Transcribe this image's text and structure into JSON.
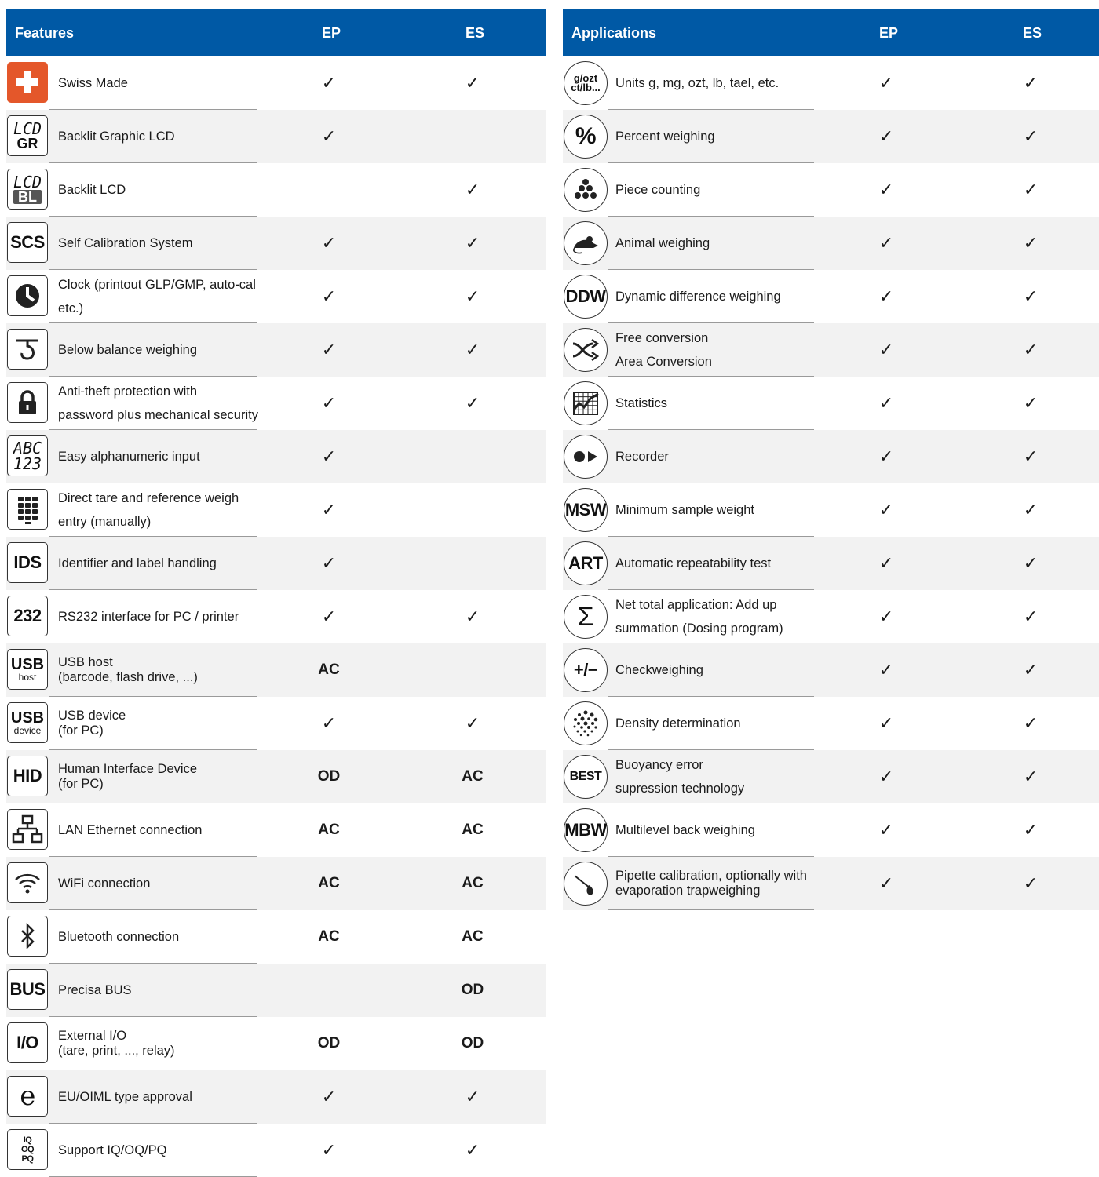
{
  "features": {
    "header": {
      "title": "Features",
      "ep": "EP",
      "es": "ES"
    },
    "rows": [
      {
        "icon": "swiss-cross-icon",
        "label": "Swiss Made",
        "ep": "✓",
        "es": "✓"
      },
      {
        "icon": "lcd-gr-icon",
        "icon_top": "LCD",
        "icon_bottom": "GR",
        "label": "Backlit Graphic LCD",
        "ep": "✓",
        "es": ""
      },
      {
        "icon": "lcd-bl-icon",
        "icon_top": "LCD",
        "icon_bottom": "BL",
        "label": "Backlit LCD",
        "ep": "",
        "es": "✓"
      },
      {
        "icon": "scs-icon",
        "icon_text": "SCS",
        "label": "Self Calibration System",
        "ep": "✓",
        "es": "✓"
      },
      {
        "icon": "clock-icon",
        "label": "Clock (printout GLP/GMP, auto-cal",
        "label2": "etc.)",
        "ep": "✓",
        "es": "✓"
      },
      {
        "icon": "below-balance-hook-icon",
        "label": "Below balance weighing",
        "ep": "✓",
        "es": "✓"
      },
      {
        "icon": "padlock-icon",
        "label": "Anti-theft protection with",
        "label2": "password plus mechanical security",
        "ep": "✓",
        "es": "✓"
      },
      {
        "icon": "abc-123-icon",
        "icon_top": "ABC",
        "icon_bottom": "123",
        "label": "Easy alphanumeric input",
        "ep": "✓",
        "es": ""
      },
      {
        "icon": "keypad-icon",
        "label": "Direct tare and reference weigh",
        "label2": "entry (manually)",
        "ep": "✓",
        "es": ""
      },
      {
        "icon": "ids-icon",
        "icon_text": "IDS",
        "label": "Identifier and label handling",
        "ep": "✓",
        "es": ""
      },
      {
        "icon": "rs232-icon",
        "icon_text": "232",
        "label": "RS232 interface for PC / printer",
        "ep": "✓",
        "es": "✓"
      },
      {
        "icon": "usb-host-icon",
        "icon_top": "USB",
        "icon_bottom": "host",
        "label": "USB host",
        "label2": "(barcode, flash drive, ...)",
        "tight": true,
        "ep": "AC",
        "es": ""
      },
      {
        "icon": "usb-device-icon",
        "icon_top": "USB",
        "icon_bottom": "device",
        "label": "USB device",
        "label2": "(for PC)",
        "tight": true,
        "ep": "✓",
        "es": "✓"
      },
      {
        "icon": "hid-icon",
        "icon_text": "HID",
        "label": "Human Interface Device",
        "label2": "(for PC)",
        "tight": true,
        "ep": "OD",
        "es": "AC"
      },
      {
        "icon": "lan-network-icon",
        "label": "LAN Ethernet connection",
        "ep": "AC",
        "es": "AC"
      },
      {
        "icon": "wifi-icon",
        "label": "WiFi connection",
        "ep": "AC",
        "es": "AC"
      },
      {
        "icon": "bluetooth-icon",
        "label": "Bluetooth connection",
        "ep": "AC",
        "es": "AC"
      },
      {
        "icon": "bus-icon",
        "icon_text": "BUS",
        "label": "Precisa BUS",
        "ep": "",
        "es": "OD"
      },
      {
        "icon": "io-icon",
        "icon_text": "I/O",
        "label": "External I/O",
        "label2": "(tare, print, ..., relay)",
        "tight": true,
        "ep": "OD",
        "es": "OD"
      },
      {
        "icon": "e-mark-icon",
        "icon_text": "e",
        "label": "EU/OIML type approval",
        "ep": "✓",
        "es": "✓"
      },
      {
        "icon": "iq-oq-pq-icon",
        "icon_text": "IQ OQ PQ",
        "label": "Support IQ/OQ/PQ",
        "ep": "✓",
        "es": "✓"
      }
    ]
  },
  "applications": {
    "header": {
      "title": "Applications",
      "ep": "EP",
      "es": "ES"
    },
    "rows": [
      {
        "icon": "units-icon",
        "icon_top": "g/ozt",
        "icon_bottom": "ct/lb...",
        "label": "Units g, mg, ozt, lb, tael, etc.",
        "ep": "✓",
        "es": "✓"
      },
      {
        "icon": "percent-icon",
        "icon_text": "%",
        "label": "Percent weighing",
        "ep": "✓",
        "es": "✓"
      },
      {
        "icon": "piece-counting-icon",
        "label": "Piece counting",
        "ep": "✓",
        "es": "✓"
      },
      {
        "icon": "mouse-icon",
        "label": "Animal weighing",
        "ep": "✓",
        "es": "✓"
      },
      {
        "icon": "ddw-icon",
        "icon_text": "DDW",
        "label": "Dynamic difference weighing",
        "ep": "✓",
        "es": "✓"
      },
      {
        "icon": "shuffle-arrows-icon",
        "label": "Free conversion",
        "label2": "Area Conversion",
        "ep": "✓",
        "es": "✓"
      },
      {
        "icon": "statistics-chart-icon",
        "label": "Statistics",
        "ep": "✓",
        "es": "✓"
      },
      {
        "icon": "recorder-icon",
        "label": "Recorder",
        "ep": "✓",
        "es": "✓"
      },
      {
        "icon": "msw-icon",
        "icon_text": "MSW",
        "label": "Minimum sample weight",
        "ep": "✓",
        "es": "✓"
      },
      {
        "icon": "art-icon",
        "icon_text": "ART",
        "label": "Automatic repeatability test",
        "ep": "✓",
        "es": "✓"
      },
      {
        "icon": "sigma-icon",
        "icon_text": "Σ",
        "label": "Net total application: Add up",
        "label2": "summation (Dosing program)",
        "ep": "✓",
        "es": "✓"
      },
      {
        "icon": "plus-minus-icon",
        "icon_text": "+/−",
        "label": "Checkweighing",
        "ep": "✓",
        "es": "✓"
      },
      {
        "icon": "density-dots-icon",
        "label": "Density determination",
        "ep": "✓",
        "es": "✓"
      },
      {
        "icon": "best-icon",
        "icon_text": "BEST",
        "label": "Buoyancy error",
        "label2": "supression technology",
        "ep": "✓",
        "es": "✓"
      },
      {
        "icon": "mbw-icon",
        "icon_text": "MBW",
        "label": "Multilevel back weighing",
        "ep": "✓",
        "es": "✓"
      },
      {
        "icon": "pipette-icon",
        "label": "Pipette calibration, optionally with",
        "label2": "evaporation trapweighing",
        "tight": true,
        "ep": "✓",
        "es": "✓"
      }
    ]
  }
}
